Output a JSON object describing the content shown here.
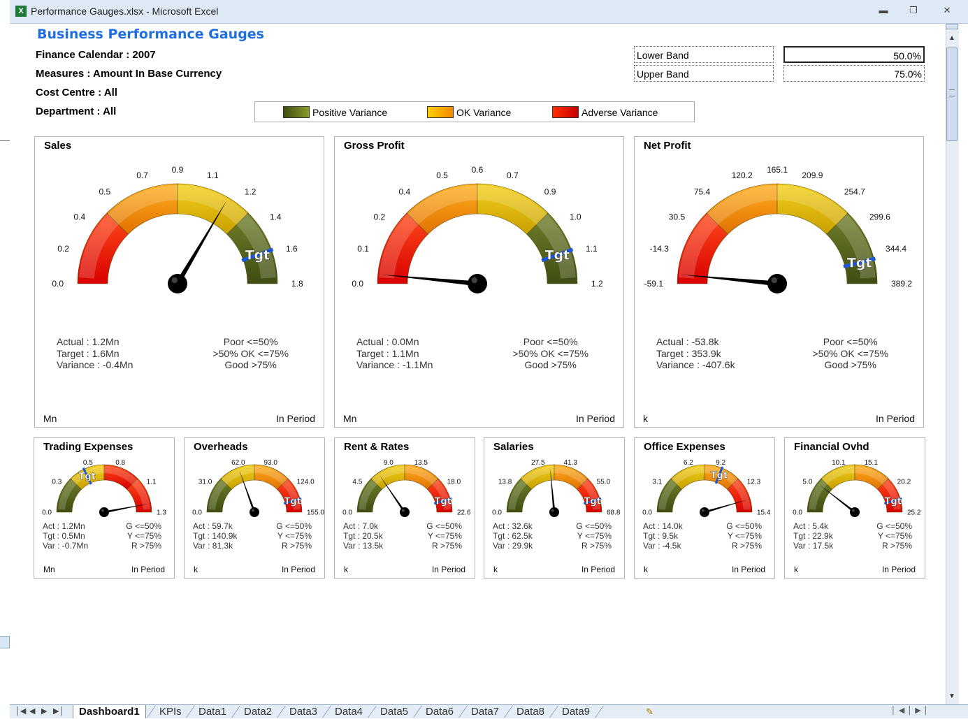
{
  "window": {
    "title": "Performance Gauges.xlsx - Microsoft Excel",
    "app_icon": "excel-icon",
    "controls": [
      "minimize",
      "restore",
      "close"
    ]
  },
  "dashboard": {
    "title": "Business Performance Gauges",
    "info": [
      "Finance Calendar : 2007",
      "Measures : Amount In Base Currency",
      "Cost Centre : All",
      "Department : All"
    ]
  },
  "bands": [
    {
      "label": "Lower Band",
      "value": "50.0%"
    },
    {
      "label": "Upper Band",
      "value": "75.0%"
    }
  ],
  "legend": [
    {
      "label": "Positive Variance",
      "color": "#55661e"
    },
    {
      "label": "OK Variance",
      "color": "#f2a400"
    },
    {
      "label": "Adverse Variance",
      "color": "#ee1a00"
    }
  ],
  "colors": {
    "red": "#f21800",
    "orange": "#f0a000",
    "yellow": "#e9c20a",
    "green": "#56661e",
    "tgt": "#1a56e0",
    "title_blue": "#1f6fe0"
  },
  "target_marker_label": "Tgt",
  "gauges": [
    {
      "title": "Sales",
      "ticks": [
        "0.0",
        "0.2",
        "0.4",
        "0.5",
        "0.7",
        "0.9",
        "1.1",
        "1.2",
        "1.4",
        "1.6",
        "1.8"
      ],
      "zones": [
        "red",
        "orange",
        "yellow",
        "green"
      ],
      "target": 0.89,
      "needle": 0.67,
      "actual": "Actual : 1.2Mn",
      "target_text": "Target : 1.6Mn",
      "variance": "Variance : -0.4Mn",
      "thresholds": [
        "Poor <=50%",
        ">50% OK <=75%",
        "Good >75%"
      ],
      "unit": "Mn",
      "period": "In Period"
    },
    {
      "title": "Gross Profit",
      "ticks": [
        "0.0",
        "0.1",
        "0.2",
        "0.4",
        "0.5",
        "0.6",
        "0.7",
        "0.9",
        "1.0",
        "1.1",
        "1.2"
      ],
      "zones": [
        "red",
        "orange",
        "yellow",
        "green"
      ],
      "target": 0.89,
      "needle": 0.03,
      "actual": "Actual : 0.0Mn",
      "target_text": "Target : 1.1Mn",
      "variance": "Variance : -1.1Mn",
      "thresholds": [
        "Poor <=50%",
        ">50% OK <=75%",
        "Good >75%"
      ],
      "unit": "Mn",
      "period": "In Period"
    },
    {
      "title": "Net Profit",
      "ticks": [
        "-59.1",
        "-14.3",
        "30.5",
        "75.4",
        "120.2",
        "165.1",
        "209.9",
        "254.7",
        "299.6",
        "344.4",
        "389.2"
      ],
      "zones": [
        "red",
        "orange",
        "yellow",
        "green"
      ],
      "target": 0.92,
      "needle": 0.03,
      "actual": "Actual : -53.8k",
      "target_text": "Target : 353.9k",
      "variance": "Variance : -407.6k",
      "thresholds": [
        "Poor <=50%",
        ">50% OK <=75%",
        "Good >75%"
      ],
      "unit": "k",
      "period": "In Period"
    }
  ],
  "small_gauges": [
    {
      "title": "Trading Expenses",
      "ticks": [
        "0.0",
        "0.3",
        "0.5",
        "0.8",
        "1.1",
        "1.3"
      ],
      "zones": [
        "green",
        "yellow",
        "red",
        "red"
      ],
      "target": 0.36,
      "needle": 0.94,
      "actual": "Act : 1.2Mn",
      "target_text": "Tgt : 0.5Mn",
      "variance": "Var : -0.7Mn",
      "thresholds": [
        "G <=50%",
        "Y <=75%",
        "R >75%"
      ],
      "unit": "Mn",
      "period": "In Period"
    },
    {
      "title": "Overheads",
      "ticks": [
        "0.0",
        "31.0",
        "62.0",
        "93.0",
        "124.0",
        "155.0"
      ],
      "zones": [
        "green",
        "yellow",
        "orange",
        "red"
      ],
      "target": 0.91,
      "needle": 0.39,
      "actual": "Act : 59.7k",
      "target_text": "Tgt : 140.9k",
      "variance": "Var : 81.3k",
      "thresholds": [
        "G <=50%",
        "Y <=75%",
        "R >75%"
      ],
      "unit": "k",
      "period": "In Period"
    },
    {
      "title": "Rent & Rates",
      "ticks": [
        "0.0",
        "4.5",
        "9.0",
        "13.5",
        "18.0",
        "22.6"
      ],
      "zones": [
        "green",
        "yellow",
        "orange",
        "red"
      ],
      "target": 0.91,
      "needle": 0.31,
      "actual": "Act : 7.0k",
      "target_text": "Tgt : 20.5k",
      "variance": "Var : 13.5k",
      "thresholds": [
        "G <=50%",
        "Y <=75%",
        "R >75%"
      ],
      "unit": "k",
      "period": "In Period"
    },
    {
      "title": "Salaries",
      "ticks": [
        "0.0",
        "13.8",
        "27.5",
        "41.3",
        "55.0",
        "68.8"
      ],
      "zones": [
        "green",
        "yellow",
        "orange",
        "red"
      ],
      "target": 0.91,
      "needle": 0.47,
      "actual": "Act : 32.6k",
      "target_text": "Tgt : 62.5k",
      "variance": "Var : 29.9k",
      "thresholds": [
        "G <=50%",
        "Y <=75%",
        "R >75%"
      ],
      "unit": "k",
      "period": "In Period"
    },
    {
      "title": "Office Expenses",
      "ticks": [
        "0.0",
        "3.1",
        "6.2",
        "9.2",
        "12.3",
        "15.4"
      ],
      "zones": [
        "green",
        "yellow",
        "orange",
        "red"
      ],
      "target": 0.62,
      "needle": 0.91,
      "actual": "Act : 14.0k",
      "target_text": "Tgt : 9.5k",
      "variance": "Var : -4.5k",
      "thresholds": [
        "G <=50%",
        "Y <=75%",
        "R >75%"
      ],
      "unit": "k",
      "period": "In Period"
    },
    {
      "title": "Financial Ovhd",
      "ticks": [
        "0.0",
        "5.0",
        "10.1",
        "15.1",
        "20.2",
        "25.2"
      ],
      "zones": [
        "green",
        "yellow",
        "orange",
        "red"
      ],
      "target": 0.91,
      "needle": 0.21,
      "actual": "Act : 5.4k",
      "target_text": "Tgt : 22.9k",
      "variance": "Var : 17.5k",
      "thresholds": [
        "G <=50%",
        "Y <=75%",
        "R >75%"
      ],
      "unit": "k",
      "period": "In Period"
    }
  ],
  "sheet_tabs": [
    "Dashboard1",
    "KPIs",
    "Data1",
    "Data2",
    "Data3",
    "Data4",
    "Data5",
    "Data6",
    "Data7",
    "Data8",
    "Data9"
  ],
  "active_tab": "Dashboard1"
}
